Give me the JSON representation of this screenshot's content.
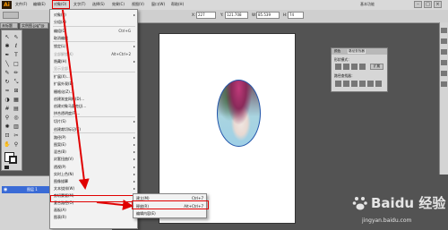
{
  "app": {
    "logo": "Ai",
    "top_right": "基本功能"
  },
  "menubar": {
    "items": [
      "文件(F)",
      "编辑(E)",
      "对象(O)",
      "文字(T)",
      "选择(S)",
      "效果(C)",
      "视图(V)",
      "窗口(W)",
      "帮助(H)"
    ]
  },
  "control": {
    "label_x": "X:",
    "x_value": "227",
    "label_y": "Y:",
    "y_value": "121.708",
    "label_w": "W:",
    "w_value": "85.539",
    "label_h": "H:",
    "h_value": "74"
  },
  "doc_tabs": [
    "未标题",
    "实例图.jpg*@"
  ],
  "effect_menu": {
    "items": [
      {
        "label": "对象(B)",
        "shortcut": "",
        "arrow": "▸",
        "disabled": false
      },
      {
        "label": "分组(A)",
        "shortcut": "",
        "arrow": "",
        "disabled": false
      },
      {
        "label": "编组(G)",
        "shortcut": "Ctrl+G",
        "arrow": "",
        "disabled": false
      },
      {
        "label": "取消编组",
        "shortcut": "",
        "arrow": "",
        "disabled": false
      },
      {
        "label": "锁定(L)",
        "shortcut": "",
        "arrow": "▸",
        "disabled": false
      },
      {
        "label": "全部解锁(K)",
        "shortcut": "Alt+Ctrl+2",
        "arrow": "",
        "disabled": true
      },
      {
        "label": "隐藏(H)",
        "shortcut": "",
        "arrow": "▸",
        "disabled": false
      },
      {
        "label": "显示全部",
        "shortcut": "",
        "arrow": "",
        "disabled": true
      },
      {
        "label": "扩展(X)...",
        "shortcut": "",
        "arrow": "",
        "disabled": false
      },
      {
        "label": "扩展外观(E)",
        "shortcut": "",
        "arrow": "",
        "disabled": false
      },
      {
        "label": "栅格化(Z)...",
        "shortcut": "",
        "arrow": "",
        "disabled": false
      },
      {
        "label": "创建渐变网格(D)...",
        "shortcut": "",
        "arrow": "",
        "disabled": false
      },
      {
        "label": "创建对象马赛克(J)...",
        "shortcut": "",
        "arrow": "",
        "disabled": false
      },
      {
        "label": "拼合透明度(F)...",
        "shortcut": "",
        "arrow": "",
        "disabled": false
      },
      {
        "label": "切片(S)",
        "shortcut": "",
        "arrow": "▸",
        "disabled": false
      },
      {
        "label": "创建裁切标记(C)",
        "shortcut": "",
        "arrow": "",
        "disabled": false
      },
      {
        "label": "路径(P)",
        "shortcut": "",
        "arrow": "▸",
        "disabled": false
      },
      {
        "label": "图案(E)",
        "shortcut": "",
        "arrow": "▸",
        "disabled": false
      },
      {
        "label": "混合(B)",
        "shortcut": "",
        "arrow": "▸",
        "disabled": false
      },
      {
        "label": "封套扭曲(V)",
        "shortcut": "",
        "arrow": "▸",
        "disabled": false
      },
      {
        "label": "透视(P)",
        "shortcut": "",
        "arrow": "▸",
        "disabled": false
      },
      {
        "label": "实时上色(N)",
        "shortcut": "",
        "arrow": "▸",
        "disabled": false
      },
      {
        "label": "图像描摹",
        "shortcut": "",
        "arrow": "▸",
        "disabled": false
      },
      {
        "label": "文本绕排(W)",
        "shortcut": "",
        "arrow": "▸",
        "disabled": false
      },
      {
        "label": "剪切蒙版(M)",
        "shortcut": "",
        "arrow": "▸",
        "disabled": false
      },
      {
        "label": "复合路径(O)",
        "shortcut": "",
        "arrow": "▸",
        "disabled": false
      },
      {
        "label": "画板(A)",
        "shortcut": "",
        "arrow": "▸",
        "disabled": false
      },
      {
        "label": "图表(R)",
        "shortcut": "",
        "arrow": "▸",
        "disabled": false
      }
    ]
  },
  "clip_submenu": {
    "items": [
      {
        "label": "建立(M)",
        "shortcut": "Ctrl+7"
      },
      {
        "label": "释放(R)",
        "shortcut": "Alt+Ctrl+7"
      },
      {
        "label": "编辑内容(E)",
        "shortcut": ""
      }
    ]
  },
  "panel": {
    "tabs": [
      "颜色",
      "路径查找器"
    ],
    "shape_modes": "形状模式：",
    "pathfinders": "路径查找器：",
    "expand": "扩展"
  },
  "layers_panel": {
    "layer_name": "图层 1"
  },
  "watermark": {
    "brand": "Baidu 经验",
    "url": "jingyan.baidu.com"
  },
  "colors": {
    "highlight_red": "#e00000",
    "selection_blue": "#3a6bd6",
    "artboard": "#ffffff",
    "workspace": "#535353"
  }
}
